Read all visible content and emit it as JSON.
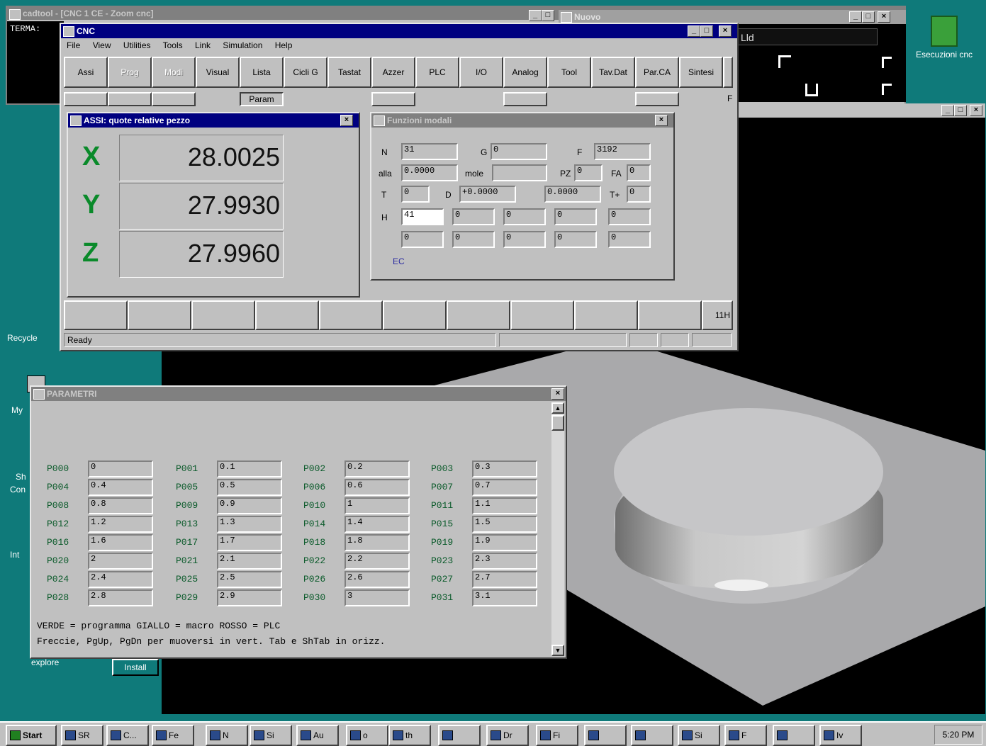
{
  "bg_window": {
    "title": "cadtool - [CNC 1 CE - Zoom cnc]",
    "label": "TERMA:",
    "right_title": "Nuovo",
    "status_text": "Lld"
  },
  "desktop": {
    "right_icon_label": "Esecuzioni cnc",
    "left_labels": [
      "Recycle",
      "My",
      "Sh",
      "Con",
      "Int",
      "explore",
      "Install"
    ]
  },
  "cnc": {
    "title": "CNC",
    "menu": [
      "File",
      "View",
      "Utilities",
      "Tools",
      "Link",
      "Simulation",
      "Help"
    ],
    "toolbar": [
      "Assi",
      "Prog",
      "Modi",
      "Visual",
      "Lista",
      "Cicli G",
      "Tastat",
      "Azzer",
      "PLC",
      "I/O",
      "Analog",
      "Tool",
      "Tav.Dat",
      "Par.CA",
      "Sintesi"
    ],
    "toolbar2_active": "Param",
    "toolbar2_right": "F",
    "bottom_right": "11H",
    "status": "Ready"
  },
  "axes_panel": {
    "title": "ASSI: quote relative pezzo",
    "axes": [
      {
        "letter": "X",
        "value": "28.0025"
      },
      {
        "letter": "Y",
        "value": "27.9930"
      },
      {
        "letter": "Z",
        "value": "27.9960"
      }
    ]
  },
  "func_panel": {
    "title": "Funzioni modali",
    "row1": [
      {
        "label": "N",
        "value": "31"
      },
      {
        "label": "G",
        "value": "0"
      },
      {
        "label": "F",
        "value": "3192"
      }
    ],
    "row2": [
      {
        "label": "alla",
        "value": "0.0000"
      },
      {
        "label": "mole",
        "value": ""
      },
      {
        "label": "PZ",
        "value": "0"
      },
      {
        "label": "FA",
        "value": "0"
      }
    ],
    "row3": [
      {
        "label": "T",
        "value": "0"
      },
      {
        "label": "D",
        "value": "+0.0000"
      },
      {
        "label": "",
        "value": "0.0000"
      },
      {
        "label": "T+",
        "value": "0"
      }
    ],
    "h_label": "H",
    "row4": [
      "41",
      "0",
      "0",
      "0",
      "0"
    ],
    "row5": [
      "0",
      "0",
      "0",
      "0",
      "0"
    ],
    "footer": "EC"
  },
  "params_panel": {
    "title": "PARAMETRI",
    "columns": [
      [
        {
          "label": "P000",
          "value": "0"
        },
        {
          "label": "P004",
          "value": "0.4"
        },
        {
          "label": "P008",
          "value": "0.8"
        },
        {
          "label": "P012",
          "value": "1.2"
        },
        {
          "label": "P016",
          "value": "1.6"
        },
        {
          "label": "P020",
          "value": "2"
        },
        {
          "label": "P024",
          "value": "2.4"
        },
        {
          "label": "P028",
          "value": "2.8"
        }
      ],
      [
        {
          "label": "P001",
          "value": "0.1"
        },
        {
          "label": "P005",
          "value": "0.5"
        },
        {
          "label": "P009",
          "value": "0.9"
        },
        {
          "label": "P013",
          "value": "1.3"
        },
        {
          "label": "P017",
          "value": "1.7"
        },
        {
          "label": "P021",
          "value": "2.1"
        },
        {
          "label": "P025",
          "value": "2.5"
        },
        {
          "label": "P029",
          "value": "2.9"
        }
      ],
      [
        {
          "label": "P002",
          "value": "0.2"
        },
        {
          "label": "P006",
          "value": "0.6"
        },
        {
          "label": "P010",
          "value": "1"
        },
        {
          "label": "P014",
          "value": "1.4"
        },
        {
          "label": "P018",
          "value": "1.8"
        },
        {
          "label": "P022",
          "value": "2.2"
        },
        {
          "label": "P026",
          "value": "2.6"
        },
        {
          "label": "P030",
          "value": "3"
        }
      ],
      [
        {
          "label": "P003",
          "value": "0.3"
        },
        {
          "label": "P007",
          "value": "0.7"
        },
        {
          "label": "P011",
          "value": "1.1"
        },
        {
          "label": "P015",
          "value": "1.5"
        },
        {
          "label": "P019",
          "value": "1.9"
        },
        {
          "label": "P023",
          "value": "2.3"
        },
        {
          "label": "P027",
          "value": "2.7"
        },
        {
          "label": "P031",
          "value": "3.1"
        }
      ]
    ],
    "legend": "VERDE = programma  GIALLO = macro  ROSSO = PLC",
    "help": "Freccie, PgUp, PgDn per muoversi in vert. Tab e ShTab in orizz."
  },
  "taskbar": {
    "start": "Start",
    "items": [
      "SR",
      "C...",
      "Fe",
      "N",
      "Si",
      "Au",
      "o",
      "th",
      "",
      "Dr",
      "Fi",
      "",
      "",
      "Si",
      "F",
      "",
      "Iv"
    ],
    "clock": "5:20 PM"
  },
  "colors": {
    "desktop": "#0f7a7a",
    "titlebar": "#000080",
    "window": "#c0c0c0",
    "axis_green": "#0a8a2a"
  }
}
